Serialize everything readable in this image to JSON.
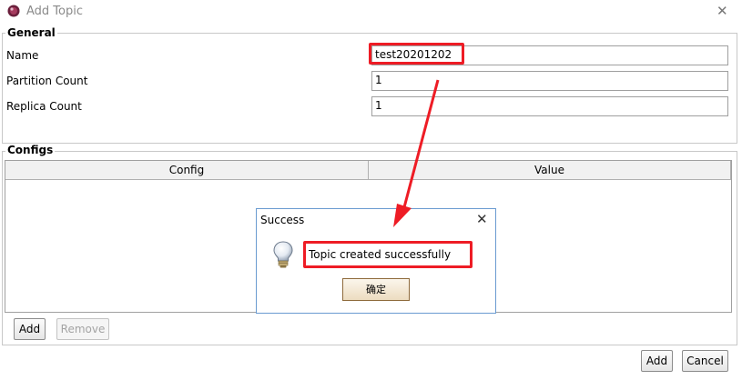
{
  "window": {
    "title": "Add Topic",
    "close_glyph": "✕"
  },
  "general": {
    "legend": "General",
    "fields": [
      {
        "label": "Name",
        "value": "test20201202"
      },
      {
        "label": "Partition Count",
        "value": "1"
      },
      {
        "label": "Replica Count",
        "value": "1"
      }
    ]
  },
  "configs": {
    "legend": "Configs",
    "columns": [
      "Config",
      "Value"
    ],
    "add_label": "Add",
    "remove_label": "Remove"
  },
  "footer": {
    "add_label": "Add",
    "cancel_label": "Cancel"
  },
  "dialog": {
    "title": "Success",
    "close_glyph": "✕",
    "message": "Topic created successfully",
    "ok_label": "确定",
    "icon": "lightbulb-icon"
  },
  "annotation": {
    "color": "#ee1c25"
  }
}
